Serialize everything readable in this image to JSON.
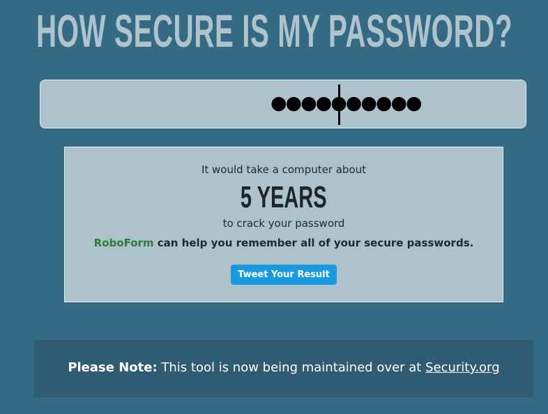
{
  "header": {
    "title": "HOW SECURE IS MY PASSWORD?"
  },
  "password_field": {
    "value": "●●●●●●●●●●"
  },
  "result": {
    "intro": "It would take a computer about",
    "duration": "5 YEARS",
    "suffix": "to crack your password",
    "promo_brand": "RoboForm",
    "promo_text": " can help you remember all of your secure passwords.",
    "tweet_label": "Tweet Your Result"
  },
  "notice": {
    "label": "Please Note:",
    "text": " This tool is now being maintained over at ",
    "link_text": "Security.org"
  },
  "colors": {
    "background": "#356a85",
    "title": "#aec3cc",
    "panel": "#adc2cb",
    "brand_green": "#2e7d32",
    "tweet_blue": "#189ae1",
    "notice_bg": "#2f5c73"
  }
}
